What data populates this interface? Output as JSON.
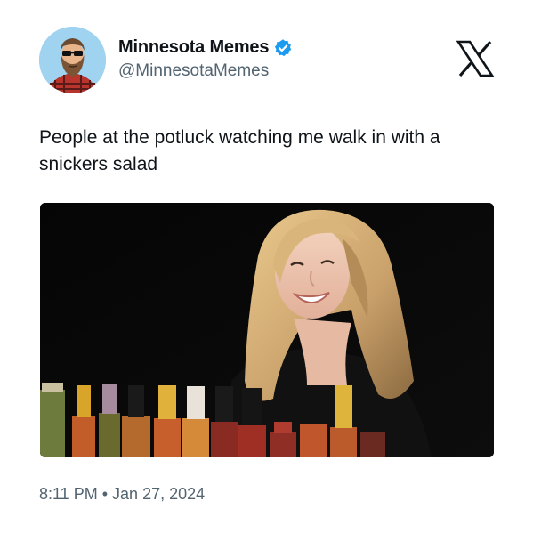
{
  "tweet": {
    "display_name": "Minnesota Memes",
    "handle": "@MinnesotaMemes",
    "verified": true,
    "text": "People at the potluck watching me walk in with a snickers salad",
    "time": "8:11 PM",
    "separator": "•",
    "date": "Jan 27, 2024"
  },
  "icons": {
    "verified": "verified-badge-icon",
    "platform": "x-logo-icon"
  },
  "colors": {
    "verified_blue": "#1d9bf0",
    "secondary_text": "#536471",
    "primary_text": "#0f1419"
  }
}
